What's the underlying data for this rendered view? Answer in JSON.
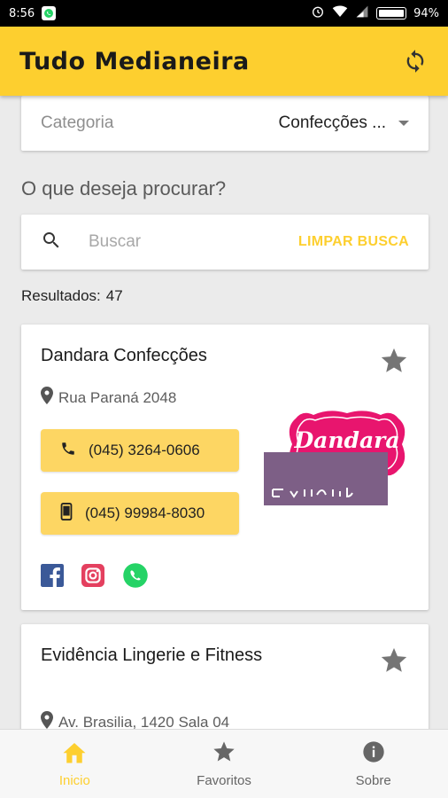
{
  "status_bar": {
    "time": "8:56",
    "battery": "94%"
  },
  "app_bar": {
    "title": "Tudo Medianeira",
    "refresh_icon": "refresh-icon"
  },
  "category": {
    "label": "Categoria",
    "selected": "Confecções ..."
  },
  "search": {
    "question": "O que deseja procurar?",
    "placeholder": "Buscar",
    "value": "",
    "clear_label": "LIMPAR BUSCA"
  },
  "results": {
    "label": "Resultados:",
    "count": "47"
  },
  "listings": [
    {
      "name": "Dandara Confecções",
      "address": "Rua Paraná 2048",
      "phone": "(045) 3264-0606",
      "mobile": "(045) 99984-8030",
      "logo_text": "Dandara",
      "logo_subtext": "CONFECÇÕES",
      "logo_color": "#e8156e",
      "socials": [
        "facebook-icon",
        "instagram-icon",
        "whatsapp-icon"
      ]
    },
    {
      "name": "Evidência Lingerie e Fitness",
      "address": "Av. Brasilia, 1420 Sala 04",
      "logo_color": "#7d5f86"
    }
  ],
  "bottom_nav": [
    {
      "label": "Inicio",
      "icon": "home-icon",
      "active": true
    },
    {
      "label": "Favoritos",
      "icon": "star-icon",
      "active": false
    },
    {
      "label": "Sobre",
      "icon": "info-icon",
      "active": false
    }
  ],
  "colors": {
    "primary": "#fdcf2f",
    "phone_button": "#fdd663",
    "background": "#ebebeb"
  }
}
